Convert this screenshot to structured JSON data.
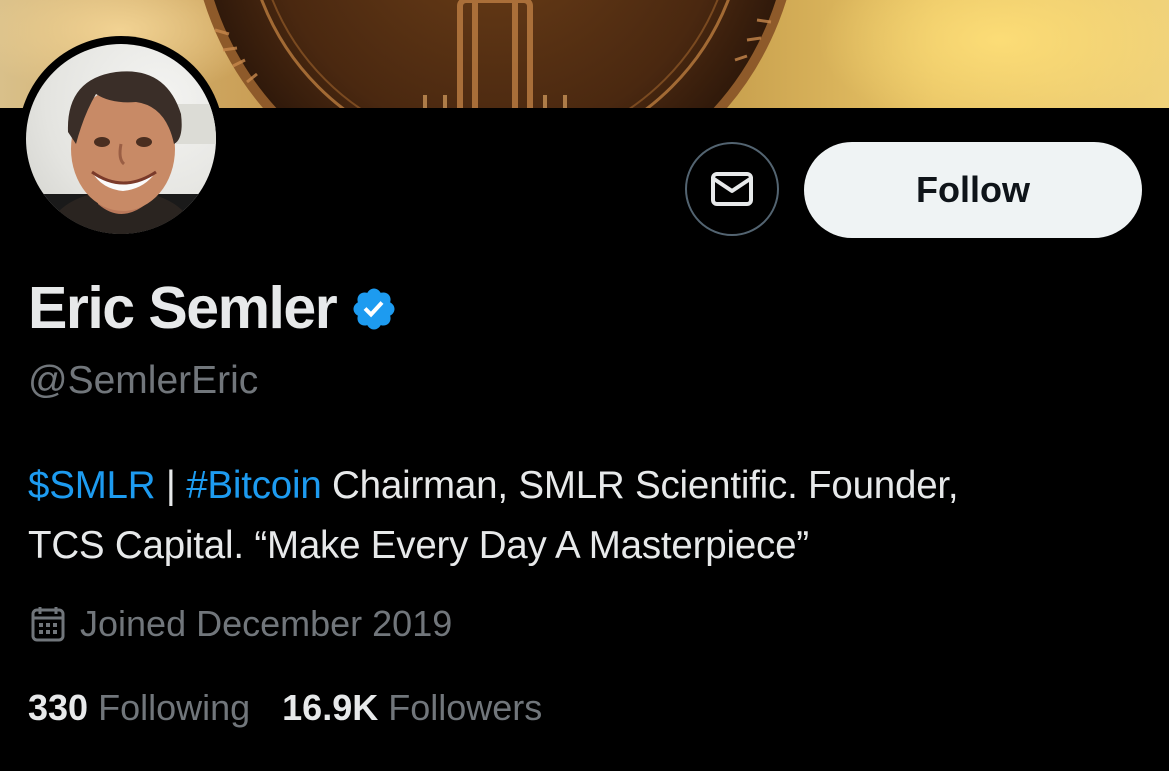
{
  "profile": {
    "name": "Eric Semler",
    "handle": "@SemlerEric",
    "verified": true
  },
  "actions": {
    "message_icon": "envelope-icon",
    "follow_label": "Follow"
  },
  "bio": {
    "cashtag": "$SMLR",
    "separator": " | ",
    "hashtag": "#Bitcoin",
    "line1_rest": " Chairman, SMLR Scientific. Founder,",
    "line2": "TCS Capital. “Make Every Day A Masterpiece”"
  },
  "joined": {
    "icon": "calendar-icon",
    "text": "Joined December 2019"
  },
  "stats": {
    "following_count": "330",
    "following_label": "Following",
    "followers_count": "16.9K",
    "followers_label": "Followers"
  },
  "colors": {
    "background": "#000000",
    "link": "#1d9bf0",
    "secondary_text": "#71767b",
    "primary_text": "#e7e9ea",
    "verified_badge": "#1d9bf0",
    "follow_button_bg": "#eff3f4"
  }
}
